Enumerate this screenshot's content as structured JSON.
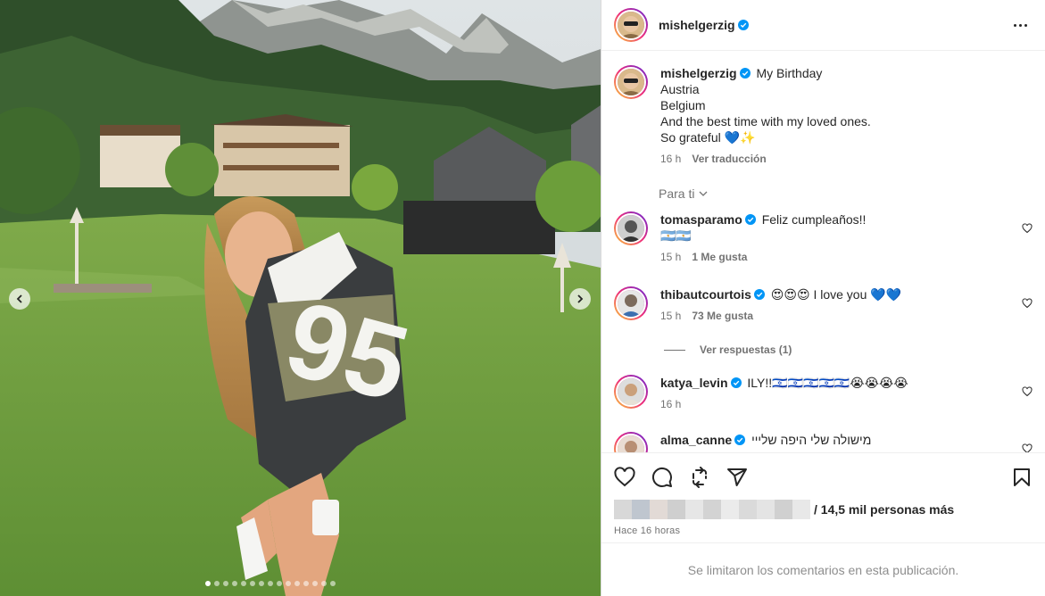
{
  "post": {
    "username": "mishelgerzig",
    "caption_lines": [
      "My Birthday",
      "Austria",
      "Belgium",
      "And the best time with my loved ones.",
      "So grateful 💙✨"
    ],
    "caption_time": "16 h",
    "translate_label": "Ver traducción",
    "filter_label": "Para ti"
  },
  "comments": [
    {
      "username": "tomasparamo",
      "text": "Feliz cumpleaños!!",
      "text2": "🇦🇷🇦🇷",
      "time": "15 h",
      "likes": "1 Me gusta"
    },
    {
      "username": "thibautcourtois",
      "text": "😍😍😍 I love you 💙💙",
      "time": "15 h",
      "likes": "73 Me gusta",
      "replies": "Ver respuestas (1)"
    },
    {
      "username": "katya_levin",
      "text": "ILY!!🇮🇱🇮🇱🇮🇱🇮🇱🇮🇱😭😭😭😭",
      "time": "16 h"
    },
    {
      "username": "alma_canne",
      "text": "מישולה שלי היפה שלייי"
    }
  ],
  "actions": {
    "likes_suffix": "/ 14,5 mil personas más",
    "posted_time": "Hace 16 horas",
    "comments_limited": "Se limitaron los comentarios en esta publicación."
  },
  "carousel": {
    "total_slides": 15,
    "active_index": 0
  },
  "colors": {
    "verified": "#0095f6",
    "grass": "#6f9a45",
    "text_secondary": "#737373"
  },
  "icons": [
    "heart-icon",
    "comment-icon",
    "repost-icon",
    "share-icon",
    "save-icon",
    "more-icon",
    "verified-icon",
    "chevron-down-icon",
    "chevron-left-icon",
    "chevron-right-icon"
  ]
}
